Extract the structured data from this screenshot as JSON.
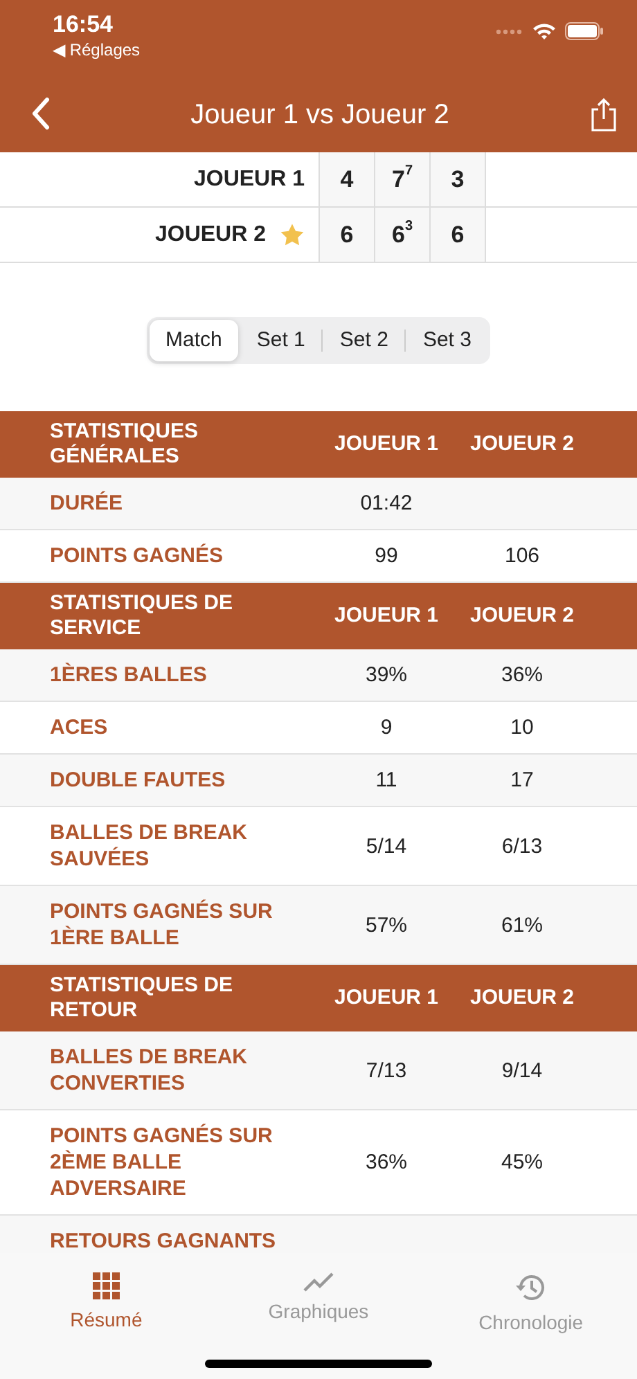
{
  "status_bar": {
    "time": "16:54",
    "back_app": "◀ Réglages"
  },
  "nav": {
    "title": "Joueur 1 vs Joueur 2"
  },
  "score": [
    {
      "name": "JOUEUR 1",
      "winner": false,
      "sets": [
        "4",
        "7$^{7}$",
        "3"
      ]
    },
    {
      "name": "JOUEUR 2",
      "winner": true,
      "sets": [
        "6",
        "6$^{3}$",
        "6"
      ]
    }
  ],
  "segments": [
    {
      "label": "Match",
      "selected": true
    },
    {
      "label": "Set 1",
      "selected": false
    },
    {
      "label": "Set 2",
      "selected": false
    },
    {
      "label": "Set 3",
      "selected": false
    }
  ],
  "sections": [
    {
      "title": "STATISTIQUES GÉNÉRALES",
      "col_1": "JOUEUR 1",
      "col_2": "JOUEUR 2",
      "rows": [
        {
          "label": "DURÉE",
          "value_1": "01:42"
        },
        {
          "label": "POINTS GAGNÉS",
          "value_1": "99",
          "value_2": "106"
        }
      ]
    },
    {
      "title": "STATISTIQUES DE SERVICE",
      "col_1": "JOUEUR 1",
      "col_2": "JOUEUR 2",
      "rows": [
        {
          "label": "1ÈRES BALLES",
          "value_1": "39%",
          "value_2": "36%"
        },
        {
          "label": "ACES",
          "value_1": "9",
          "value_2": "10"
        },
        {
          "label": "DOUBLE FAUTES",
          "value_1": "11",
          "value_2": "17"
        },
        {
          "label": "BALLES DE BREAK SAUVÉES",
          "value_1": "5/14",
          "value_2": "6/13"
        },
        {
          "label": "POINTS GAGNÉS SUR 1ÈRE BALLE",
          "value_1": "57%",
          "value_2": "61%"
        }
      ]
    },
    {
      "title": "STATISTIQUES DE RETOUR",
      "col_1": "JOUEUR 1",
      "col_2": "JOUEUR 2",
      "rows": [
        {
          "label": "BALLES DE BREAK CONVERTIES",
          "value_1": "7/13",
          "value_2": "9/14"
        },
        {
          "label": "POINTS GAGNÉS SUR 2ÈME BALLE ADVERSAIRE",
          "value_1": "36%",
          "value_2": "45%"
        },
        {
          "label": "RETOURS GAGNANTS"
        }
      ]
    }
  ],
  "tab_bar": [
    {
      "label": "Résumé",
      "kind": "grid",
      "selected": true
    },
    {
      "label": "Graphiques",
      "kind": "chart",
      "selected": false
    },
    {
      "label": "Chronologie",
      "kind": "history",
      "selected": false
    }
  ]
}
